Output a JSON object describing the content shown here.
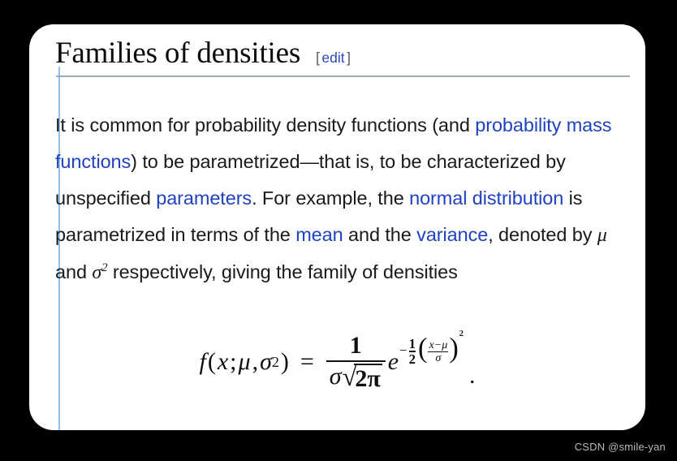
{
  "card": {
    "background": "#ffffff",
    "left_accent_color": "#8dc0ef",
    "rule_color": "#a2a9b1"
  },
  "heading": {
    "title": "Families of densities",
    "bracket_open": "[",
    "edit_label": "edit",
    "bracket_close": "]",
    "link_color": "#2b49c4"
  },
  "body": {
    "link_color": "#2042c0",
    "text_color": "#1a1a1a",
    "segments": [
      {
        "type": "text",
        "value": "It is common for probability density functions (and "
      },
      {
        "type": "link",
        "value": "probability mass functions"
      },
      {
        "type": "text",
        "value": ") to be parametrized—that is, to be characterized by unspecified "
      },
      {
        "type": "link",
        "value": "parameters"
      },
      {
        "type": "text",
        "value": ". For example, the "
      },
      {
        "type": "link",
        "value": "normal distribution"
      },
      {
        "type": "text",
        "value": " is parametrized in terms of the "
      },
      {
        "type": "link",
        "value": "mean"
      },
      {
        "type": "text",
        "value": " and the "
      },
      {
        "type": "link",
        "value": "variance"
      },
      {
        "type": "text",
        "value": ", denoted by "
      },
      {
        "type": "math",
        "value": "μ"
      },
      {
        "type": "text",
        "value": " and "
      },
      {
        "type": "math",
        "value": "σ²"
      },
      {
        "type": "text",
        "value": " respectively, giving the family of densities"
      }
    ],
    "plain_text": "It is common for probability density functions (and probability mass functions) to be parametrized—that is, to be characterized by unspecified parameters. For example, the normal distribution is parametrized in terms of the mean and the variance, denoted by μ and σ² respectively, giving the family of densities"
  },
  "formula": {
    "latex": "f(x;\\mu,\\sigma^2) = \\frac{1}{\\sigma\\sqrt{2\\pi}} e^{-\\frac{1}{2}\\left(\\frac{x-\\mu}{\\sigma}\\right)^2}.",
    "plain": "f(x; μ, σ²) = 1 / (σ√(2π)) · e^(−½((x−μ)/σ)²).",
    "lhs": {
      "f": "f",
      "paren_open": "(",
      "x": "x",
      "semicolon": ";",
      "mu": "μ",
      "comma": ",",
      "sigma": "σ",
      "sigma_power": "2",
      "paren_close": ")"
    },
    "equals": "=",
    "fraction": {
      "numerator": "1",
      "denominator_sigma": "σ",
      "radical": "√",
      "radicand": "2π"
    },
    "exponential_base": "e",
    "exponent": {
      "minus": "−",
      "half_numerator": "1",
      "half_denominator": "2",
      "paren_open": "(",
      "inner_numerator": "x−μ",
      "inner_denominator": "σ",
      "paren_close": ")",
      "power": "2"
    },
    "terminator": "."
  },
  "watermark": {
    "text": "CSDN @smile-yan",
    "color": "#b9b9b9"
  }
}
